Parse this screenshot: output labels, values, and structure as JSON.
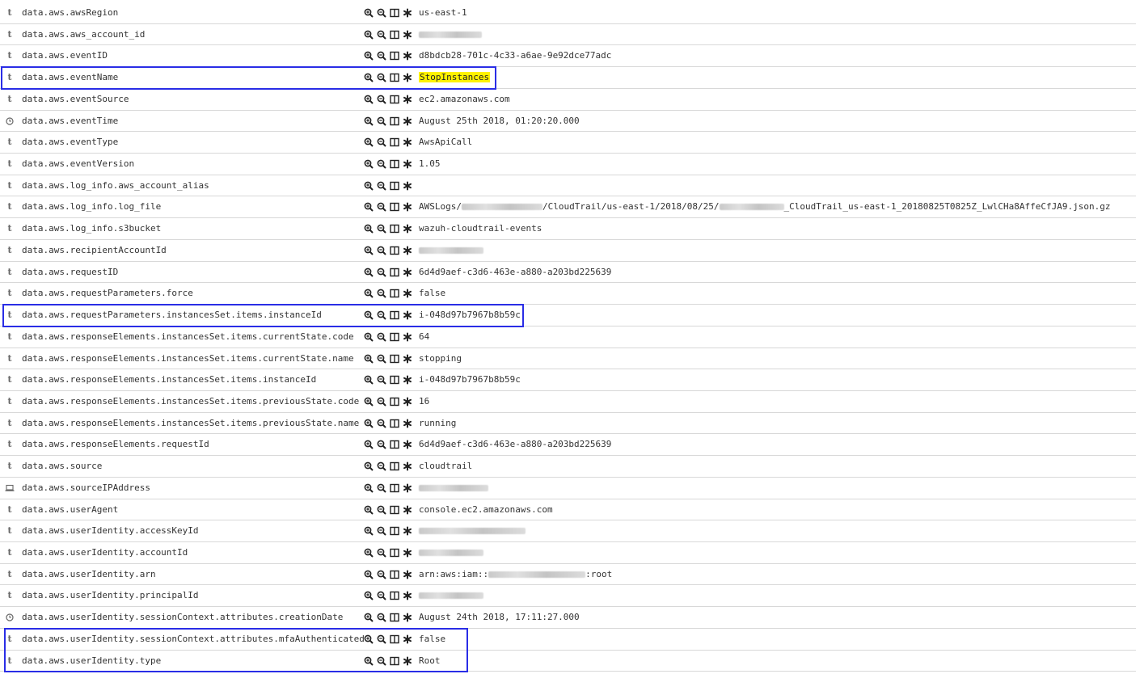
{
  "rows": [
    {
      "type": "t",
      "field": "data.aws.awsRegion",
      "value": "us-east-1"
    },
    {
      "type": "t",
      "field": "data.aws.aws_account_id",
      "value": ""
    },
    {
      "type": "t",
      "field": "data.aws.eventID",
      "value": "d8bdcb28-701c-4c33-a6ae-9e92dce77adc"
    },
    {
      "type": "t",
      "field": "data.aws.eventName",
      "value": "StopInstances"
    },
    {
      "type": "t",
      "field": "data.aws.eventSource",
      "value": "ec2.amazonaws.com"
    },
    {
      "type": "date",
      "field": "data.aws.eventTime",
      "value": "August 25th 2018, 01:20:20.000"
    },
    {
      "type": "t",
      "field": "data.aws.eventType",
      "value": "AwsApiCall"
    },
    {
      "type": "t",
      "field": "data.aws.eventVersion",
      "value": "1.05"
    },
    {
      "type": "t",
      "field": "data.aws.log_info.aws_account_alias",
      "value": ""
    },
    {
      "type": "t",
      "field": "data.aws.log_info.log_file",
      "value_parts": [
        "AWSLogs/",
        "/CloudTrail/us-east-1/2018/08/25/",
        "_CloudTrail_us-east-1_20180825T0825Z_LwlCHa8AffeCfJA9.json.gz"
      ]
    },
    {
      "type": "t",
      "field": "data.aws.log_info.s3bucket",
      "value": "wazuh-cloudtrail-events"
    },
    {
      "type": "t",
      "field": "data.aws.recipientAccountId",
      "value": ""
    },
    {
      "type": "t",
      "field": "data.aws.requestID",
      "value": "6d4d9aef-c3d6-463e-a880-a203bd225639"
    },
    {
      "type": "t",
      "field": "data.aws.requestParameters.force",
      "value": "false"
    },
    {
      "type": "t",
      "field": "data.aws.requestParameters.instancesSet.items.instanceId",
      "value": "i-048d97b7967b8b59c"
    },
    {
      "type": "t",
      "field": "data.aws.responseElements.instancesSet.items.currentState.code",
      "value": "64"
    },
    {
      "type": "t",
      "field": "data.aws.responseElements.instancesSet.items.currentState.name",
      "value": "stopping"
    },
    {
      "type": "t",
      "field": "data.aws.responseElements.instancesSet.items.instanceId",
      "value": "i-048d97b7967b8b59c"
    },
    {
      "type": "t",
      "field": "data.aws.responseElements.instancesSet.items.previousState.code",
      "value": "16"
    },
    {
      "type": "t",
      "field": "data.aws.responseElements.instancesSet.items.previousState.name",
      "value": "running"
    },
    {
      "type": "t",
      "field": "data.aws.responseElements.requestId",
      "value": "6d4d9aef-c3d6-463e-a880-a203bd225639"
    },
    {
      "type": "t",
      "field": "data.aws.source",
      "value": "cloudtrail"
    },
    {
      "type": "ip",
      "field": "data.aws.sourceIPAddress",
      "value": ""
    },
    {
      "type": "t",
      "field": "data.aws.userAgent",
      "value": "console.ec2.amazonaws.com"
    },
    {
      "type": "t",
      "field": "data.aws.userIdentity.accessKeyId",
      "value": ""
    },
    {
      "type": "t",
      "field": "data.aws.userIdentity.accountId",
      "value": ""
    },
    {
      "type": "t",
      "field": "data.aws.userIdentity.arn",
      "value_parts": [
        "arn:aws:iam::",
        ":root"
      ]
    },
    {
      "type": "t",
      "field": "data.aws.userIdentity.principalId",
      "value": ""
    },
    {
      "type": "date",
      "field": "data.aws.userIdentity.sessionContext.attributes.creationDate",
      "value": "August 24th 2018, 17:11:27.000"
    },
    {
      "type": "t",
      "field": "data.aws.userIdentity.sessionContext.attributes.mfaAuthenticated",
      "value": "false"
    },
    {
      "type": "t",
      "field": "data.aws.userIdentity.type",
      "value": "Root"
    }
  ],
  "icons": {
    "t": "string-type-icon",
    "date": "clock-icon",
    "ip": "ip-address-icon",
    "actions": [
      "filter-for-value-icon",
      "filter-out-value-icon",
      "toggle-column-icon",
      "filter-exists-icon"
    ]
  },
  "highlight_color": "#2a2de6",
  "value_highlight_color": "#fff200"
}
